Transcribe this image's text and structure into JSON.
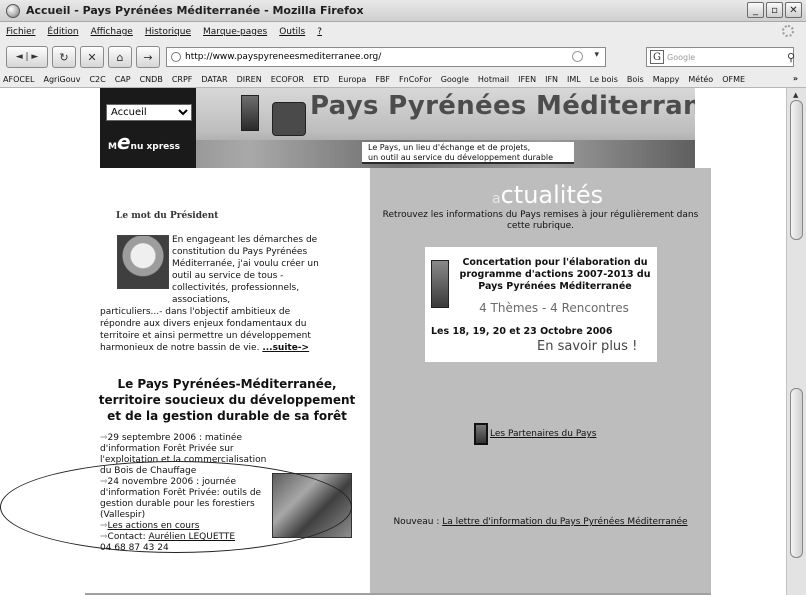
{
  "window": {
    "title": "Accueil - Pays Pyrénées Méditerranée - Mozilla Firefox",
    "buttons": [
      "_",
      "▫",
      "✕"
    ]
  },
  "menu": {
    "items": [
      "Fichier",
      "Édition",
      "Affichage",
      "Historique",
      "Marque-pages",
      "Outils",
      "?"
    ]
  },
  "nav": {
    "url": "http://www.payspyreneesmediterranee.org/",
    "search_placeholder": "Google",
    "search_engine_letter": "G",
    "dropdown_glyph": "▾",
    "back_label": "◄ | ►",
    "reload_label": "↻",
    "stop_label": "✕",
    "home_label": "⌂",
    "go_label": "→"
  },
  "bookmarks": {
    "items": [
      "AFOCEL",
      "AgriGouv",
      "C2C",
      "CAP",
      "CNDB",
      "CRPF",
      "DATAR",
      "DIREN",
      "ECOFOR",
      "ETD",
      "Europa",
      "FBF",
      "FnCoFor",
      "Google",
      "Hotmail",
      "IFEN",
      "IFN",
      "IML",
      "Le bois",
      "Bois",
      "Mappy",
      "Météo",
      "OFME"
    ],
    "more": "»"
  },
  "banner": {
    "site_title": "Pays Pyrénées Méditerranée",
    "select_value": "Accueil",
    "menu_express_prefix": "M",
    "menu_express_big": "e",
    "menu_express_rest": "nu xpress",
    "tagline_line1": "Le Pays, un lieu d'échange et de projets,",
    "tagline_line2": "un outil au service du développement durable"
  },
  "president": {
    "heading": "Le mot du Président",
    "text_indented": "En engageant les démarches de constitution du Pays Pyrénées Méditerranée, j'ai voulu créer un outil au service de tous -collectivités, professionnels, associations,",
    "text_full": "particuliers...- dans l'objectif ambitieux de répondre aux divers enjeux fondamentaux du territoire et ainsi permettre un développement harmonieux de notre bassin de vie.",
    "more_link": "...suite->"
  },
  "foret": {
    "heading": "Le Pays Pyrénées-Méditerranée, territoire soucieux du développement et de la gestion durable de sa forêt",
    "arrow_glyph": "⇒",
    "news1": "29 septembre 2006 : matinée d'information Forêt Privée sur l'exploitation et la commercialisation du Bois de Chauffage",
    "news2": "24 novembre 2006 : journée d'information Forêt Privée: outils de gestion durable pour les forestiers (Vallespir)",
    "actions_link": "Les actions en cours",
    "contact_label": "Contact: ",
    "contact_name": "Aurélien LEQUETTE",
    "phone": "04 68 87 43 24"
  },
  "actualites": {
    "title_initial": "a",
    "title_rest": "ctualités",
    "subtitle": "Retrouvez les informations du Pays remises à jour régulièrement dans cette rubrique.",
    "promo_head": "Concertation pour l'élaboration du programme d'actions 2007-2013 du Pays Pyrénées Méditerranée",
    "promo_themes": "4 Thèmes - 4 Rencontres",
    "promo_dates": "Les 18, 19, 20 et 23 Octobre 2006",
    "promo_more": "En savoir plus !",
    "partners_link": "Les Partenaires du Pays",
    "lettre_prefix": "Nouveau : ",
    "lettre_link": "La lettre d'information du Pays Pyrénées Méditerranée"
  }
}
